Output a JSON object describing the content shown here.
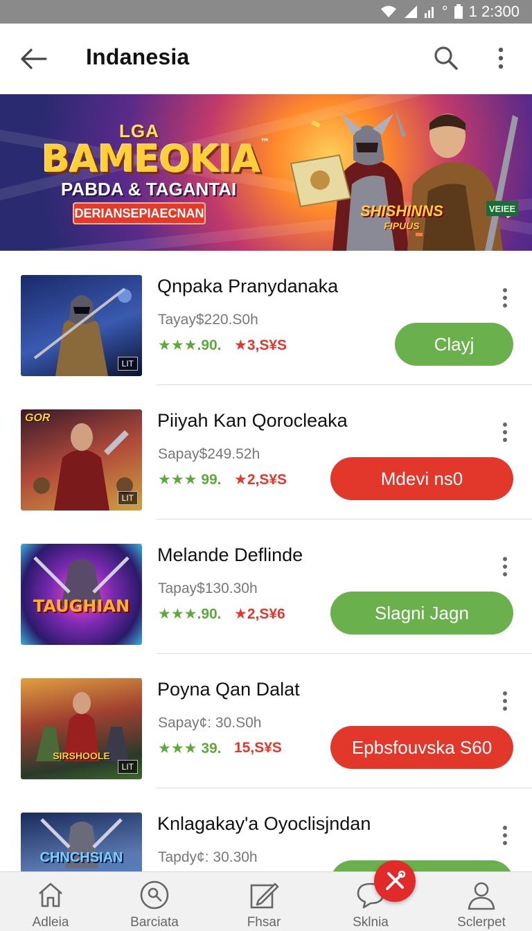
{
  "status_bar": {
    "time": "1 2:300",
    "indicator_text": "°"
  },
  "app_bar": {
    "title": "Indanesia",
    "back_icon": "back-arrow-icon",
    "search_icon": "search-icon",
    "more_icon": "more-vertical-icon"
  },
  "banner": {
    "kicker": "LGA",
    "title": "BAMEOKIA",
    "trademark": "™",
    "subtitle": "PABDA & TAGANTAI",
    "cta_label": "DERIANSEPIAECNAN",
    "badge": "VEIEE",
    "logo_text": "SHISHINNS",
    "logo_sub": "FIPUUS"
  },
  "list": {
    "items": [
      {
        "title": "Qnpaka Pranydanaka",
        "price": "Tayay$220.S0h",
        "rating": "★★★.90.",
        "reviews": "★3,S¥S",
        "button_label": "Clayj",
        "button_style": "green",
        "thumb_tag": "LIT",
        "thumb_colors": [
          "#1a2a6a",
          "#3a5ab0",
          "#8a6a3a"
        ]
      },
      {
        "title": "Piiyah Kan Qorocleaka",
        "price": "Sapay$249.52h",
        "rating": "★★★ 99.",
        "reviews": "★2,S¥S",
        "button_label": "Mdevi  ns0",
        "button_style": "red",
        "thumb_tag": "LIT",
        "thumb_badge": "GOR",
        "thumb_colors": [
          "#3a1a2a",
          "#b04a3a",
          "#d0a040"
        ]
      },
      {
        "title": "Melande Deflinde",
        "price": "Tapay$130.30h",
        "rating": "★★★.90.",
        "reviews": "★2,S¥6",
        "button_label": "Slagni Jagn",
        "button_style": "green",
        "thumb_text": "TAUGHIAN",
        "thumb_colors": [
          "#2a1a6a",
          "#c04ab0",
          "#3ab0e0"
        ]
      },
      {
        "title": "Poyna Qan Dalat",
        "price": "Sapay¢: 30.S0h",
        "rating": "★★★ 39.",
        "reviews": "15,S¥S",
        "button_label": "Epbsfouvska S60",
        "button_style": "red",
        "thumb_tag": "LIT",
        "thumb_text": "SIRSHOOLE",
        "thumb_colors": [
          "#2a3a2a",
          "#a04030",
          "#e0a040"
        ]
      },
      {
        "title": "Knlagakay'a Oyoclisjndan",
        "price": "Tapdy¢: 30.30h",
        "rating": "",
        "reviews": "",
        "button_label": "",
        "button_style": "green",
        "thumb_text": "CHNCHSIAN",
        "thumb_colors": [
          "#1a2a5a",
          "#5a7ab0",
          "#3a8ae0"
        ]
      }
    ]
  },
  "bottom_nav": {
    "items": [
      {
        "label": "Adleia",
        "icon": "home-icon"
      },
      {
        "label": "Barciata",
        "icon": "search-circle-icon"
      },
      {
        "label": "Fhsar",
        "icon": "edit-icon"
      },
      {
        "label": "Sklnia",
        "icon": "chat-icon"
      },
      {
        "label": "Sclerpet",
        "icon": "profile-icon"
      }
    ],
    "fab_icon": "tools-icon"
  },
  "colors": {
    "accent_green": "#6ab04c",
    "accent_red": "#e2382c",
    "status_bar": "#8a8a8a"
  }
}
